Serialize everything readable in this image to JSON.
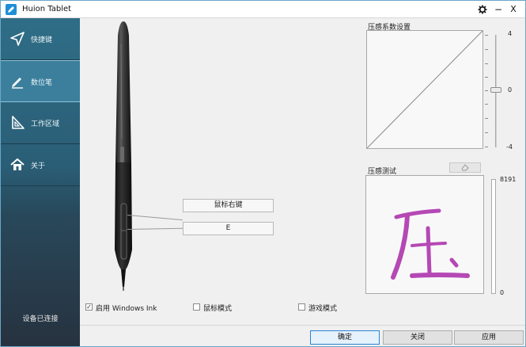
{
  "window": {
    "title": "Huion Tablet"
  },
  "titlebar_buttons": {
    "settings_icon": "gear-icon",
    "minimize": "−",
    "close": "X"
  },
  "sidebar": {
    "items": [
      {
        "label": "快捷键",
        "icon": "send-icon",
        "active": false
      },
      {
        "label": "数位笔",
        "icon": "pen-icon",
        "active": true
      },
      {
        "label": "工作区域",
        "icon": "triangle-ruler-icon",
        "active": false
      },
      {
        "label": "关于",
        "icon": "home-icon",
        "active": false
      }
    ],
    "device_status": "设备已连接"
  },
  "pen_buttons": {
    "upper": "鼠标右键",
    "lower": "E"
  },
  "options": {
    "windows_ink": {
      "label": "启用 Windows Ink",
      "checked": true
    },
    "mouse_mode": {
      "label": "鼠标模式",
      "checked": false
    },
    "game_mode": {
      "label": "游戏模式",
      "checked": false
    }
  },
  "pressure_curve": {
    "title": "压感系数设置",
    "slider": {
      "max_label": "4",
      "mid_label": "0",
      "min_label": "-4",
      "value": 0
    }
  },
  "pressure_test": {
    "title": "压感测试",
    "max_label": "8191",
    "min_label": "0",
    "current_level": 0,
    "sample_character": "压",
    "ink_color": "#b548b5"
  },
  "actions": {
    "ok": "确定",
    "close": "关闭",
    "apply": "应用"
  },
  "colors": {
    "accent": "#2b84d4",
    "sidebar_top": "#2f6d86",
    "sidebar_bottom": "#27323f"
  }
}
